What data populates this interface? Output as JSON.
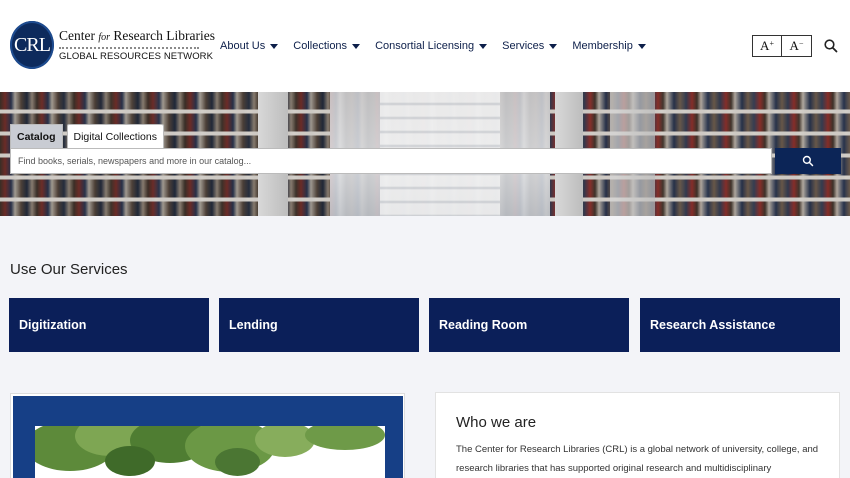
{
  "header": {
    "logo": {
      "monogram": "CRL",
      "name_part1": "Center ",
      "name_for": "for",
      "name_part2": " Research Libraries",
      "tagline": "GLOBAL RESOURCES NETWORK"
    },
    "nav": [
      {
        "label": "About Us"
      },
      {
        "label": "Collections"
      },
      {
        "label": "Consortial Licensing"
      },
      {
        "label": "Services"
      },
      {
        "label": "Membership"
      }
    ],
    "font_increase_label": "A",
    "font_increase_sign": "+",
    "font_decrease_label": "A",
    "font_decrease_sign": "−",
    "search_icon": "search-icon"
  },
  "hero": {
    "tabs": [
      {
        "label": "Catalog",
        "active": true
      },
      {
        "label": "Digital Collections",
        "active": false
      }
    ],
    "search_placeholder": "Find books, serials, newspapers and more in our catalog...",
    "search_button_icon": "search-icon"
  },
  "services": {
    "title": "Use Our Services",
    "tiles": [
      {
        "label": "Digitization"
      },
      {
        "label": "Lending"
      },
      {
        "label": "Reading Room"
      },
      {
        "label": "Research Assistance"
      }
    ]
  },
  "about": {
    "title": "Who we are",
    "text": "The Center for Research Libraries (CRL) is a global network of university, college, and research libraries that has supported original research and multidisciplinary"
  },
  "colors": {
    "brand_navy": "#0b1f59",
    "background": "#f3f4f8"
  }
}
